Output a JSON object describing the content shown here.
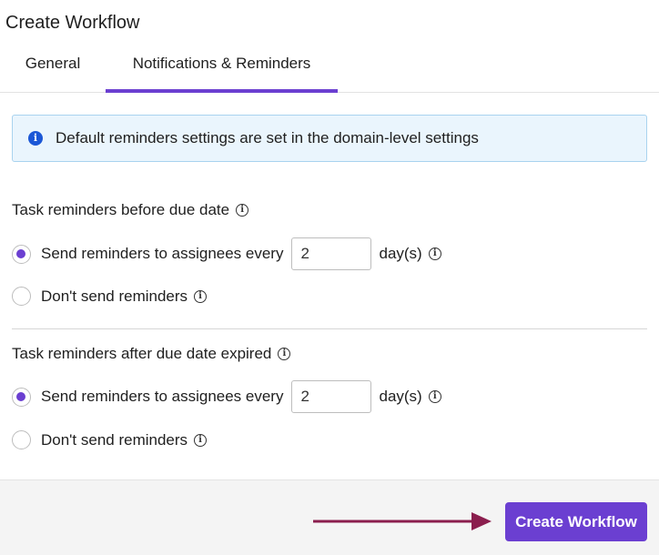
{
  "window": {
    "title": "Create Workflow"
  },
  "tabs": [
    {
      "label": "General",
      "active": false
    },
    {
      "label": "Notifications & Reminders",
      "active": true
    }
  ],
  "banner": {
    "icon": "info-icon",
    "text": "Default reminders settings are set in the domain-level settings"
  },
  "before_due": {
    "label": "Task reminders before due date",
    "option_send": "Send reminders to assignees every",
    "interval_value": "2",
    "unit": "day(s)",
    "option_none": "Don't send reminders",
    "selected": "send"
  },
  "after_due": {
    "label": "Task reminders after due date expired",
    "option_send": "Send reminders to assignees every",
    "interval_value": "2",
    "unit": "day(s)",
    "option_none": "Don't send reminders",
    "selected": "send"
  },
  "footer": {
    "create_label": "Create Workflow"
  },
  "colors": {
    "accent": "#6b3fd1",
    "info_bg": "#eaf5fd",
    "info_border": "#a9d3ef",
    "info_icon": "#1b57d6",
    "arrow": "#8b1e4e"
  }
}
